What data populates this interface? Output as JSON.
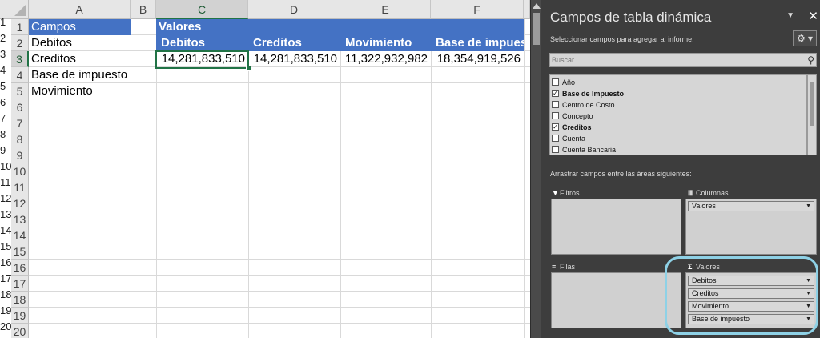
{
  "columns": [
    "A",
    "B",
    "C",
    "D",
    "E",
    "F"
  ],
  "selected_column": "C",
  "rows": [
    "1",
    "2",
    "3",
    "4",
    "5",
    "6",
    "7",
    "8",
    "9",
    "10",
    "11",
    "12",
    "13",
    "14",
    "15",
    "16",
    "17",
    "18",
    "19",
    "20"
  ],
  "ghost_rows": [
    "1",
    "2",
    "3",
    "4",
    "5",
    "6",
    "7",
    "8",
    "9",
    "10",
    "11",
    "12",
    "13",
    "14",
    "15",
    "16",
    "17",
    "18",
    "19",
    "20"
  ],
  "cells": {
    "a1": "Campos",
    "a2": "Debitos",
    "a3": "Creditos",
    "a4": "Base de impuesto",
    "a5": "Movimiento",
    "c1": "Valores",
    "c2": "Debitos",
    "d2": "Creditos",
    "e2": "Movimiento",
    "f2": "Base de impuesto",
    "c3": "14,281,833,510",
    "d3": "14,281,833,510",
    "e3": "11,322,932,982",
    "f3": "18,354,919,526"
  },
  "panel": {
    "title": "Campos de tabla dinámica",
    "subtitle": "Seleccionar campos para agregar al informe:",
    "search_placeholder": "Buscar",
    "fields": [
      {
        "label": "Año",
        "checked": false
      },
      {
        "label": "Base de Impuesto",
        "checked": true
      },
      {
        "label": "Centro de Costo",
        "checked": false
      },
      {
        "label": "Concepto",
        "checked": false
      },
      {
        "label": "Creditos",
        "checked": true
      },
      {
        "label": "Cuenta",
        "checked": false
      },
      {
        "label": "Cuenta Bancaria",
        "checked": false
      }
    ],
    "drag_hint": "Arrastrar campos entre las áreas siguientes:",
    "filters_label": "Filtros",
    "columns_label": "Columnas",
    "rows_label": "Filas",
    "values_label": "Valores",
    "column_pills": [
      "Valores"
    ],
    "value_pills": [
      "Debitos",
      "Creditos",
      "Movimiento",
      "Base de impuesto"
    ]
  },
  "colors": {
    "header_blue": "#4472c4",
    "selection_green": "#217346",
    "panel_bg": "#3d3d3d",
    "highlight": "#8ed1e6"
  }
}
